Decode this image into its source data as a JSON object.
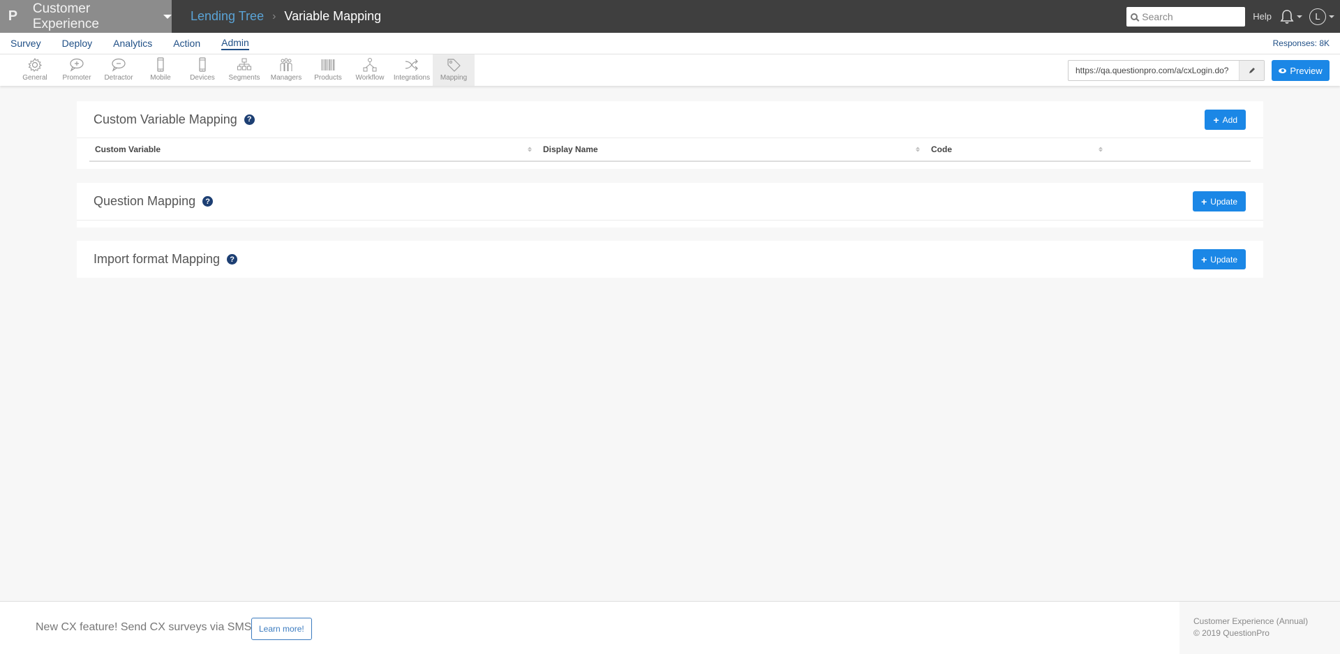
{
  "topbar": {
    "logo": "P",
    "product": "Customer Experience",
    "breadcrumb_parent": "Lending Tree",
    "breadcrumb_separator": "›",
    "breadcrumb_current": "Variable Mapping",
    "search_placeholder": "Search",
    "help": "Help",
    "avatar_initial": "L"
  },
  "nav": {
    "items": [
      "Survey",
      "Deploy",
      "Analytics",
      "Action",
      "Admin"
    ],
    "active": "Admin",
    "responses": "Responses: 8K"
  },
  "toolbar": {
    "items": [
      {
        "label": "General",
        "icon": "gear-icon"
      },
      {
        "label": "Promoter",
        "icon": "speech-plus-icon"
      },
      {
        "label": "Detractor",
        "icon": "speech-minus-icon"
      },
      {
        "label": "Mobile",
        "icon": "mobile-icon"
      },
      {
        "label": "Devices",
        "icon": "devices-icon"
      },
      {
        "label": "Segments",
        "icon": "sitemap-icon"
      },
      {
        "label": "Managers",
        "icon": "users-icon"
      },
      {
        "label": "Products",
        "icon": "barcode-icon"
      },
      {
        "label": "Workflow",
        "icon": "workflow-icon"
      },
      {
        "label": "Integrations",
        "icon": "shuffle-icon"
      },
      {
        "label": "Mapping",
        "icon": "tag-icon"
      }
    ],
    "active": "Mapping",
    "survey_url": "https://qa.questionpro.com/a/cxLogin.do?",
    "preview_label": "Preview"
  },
  "panels": {
    "custom_variable": {
      "title": "Custom Variable Mapping",
      "button": "Add",
      "columns": [
        "Custom Variable",
        "Display Name",
        "Code"
      ],
      "rows": []
    },
    "question": {
      "title": "Question Mapping",
      "button": "Update"
    },
    "import_format": {
      "title": "Import format Mapping",
      "button": "Update"
    }
  },
  "footer": {
    "promo": "New CX feature! Send CX surveys via SMS",
    "learn_more": "Learn more!",
    "plan": "Customer Experience (Annual)",
    "copyright": "© 2019 QuestionPro"
  },
  "colors": {
    "primary": "#1b87e6",
    "nav_text": "#1f4f86",
    "topbar": "#3f3f3f",
    "brand_bg": "#8c8c8c"
  }
}
